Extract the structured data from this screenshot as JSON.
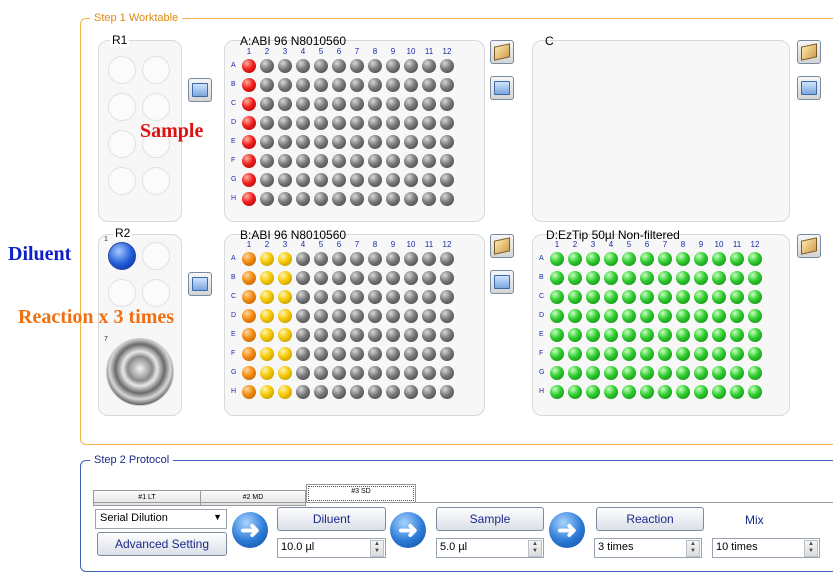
{
  "step1": {
    "legend": "Step 1 Worktable",
    "rack_r1": {
      "label": "R1"
    },
    "rack_r2": {
      "label": "R2",
      "slot1_num": "1",
      "slot7_num": "7"
    },
    "plate_a": {
      "title": "A:ABI 96 N8010560"
    },
    "plate_b": {
      "title": "B:ABI 96 N8010560"
    },
    "plate_c": {
      "title": "C"
    },
    "plate_d": {
      "title": "D:EzTip 50µl Non-filtered"
    },
    "columns": [
      "1",
      "2",
      "3",
      "4",
      "5",
      "6",
      "7",
      "8",
      "9",
      "10",
      "11",
      "12"
    ],
    "rows": [
      "A",
      "B",
      "C",
      "D",
      "E",
      "F",
      "G",
      "H"
    ]
  },
  "annotations": {
    "sample": "Sample",
    "diluent": "Diluent",
    "reaction": "Reaction x 3 times"
  },
  "step2": {
    "legend": "Step 2 Protocol",
    "tabs": [
      "#1 LT",
      "#2 MD",
      "#3 SD"
    ],
    "mode_select": "Serial Dilution",
    "advanced_button": "Advanced Setting",
    "diluent_button": "Diluent",
    "diluent_value": "10.0 µl",
    "sample_button": "Sample",
    "sample_value": "5.0 µl",
    "reaction_button": "Reaction",
    "reaction_value": "3 times",
    "mix_label": "Mix",
    "mix_value": "10 times"
  },
  "colors": {
    "worktable_border": "#f2b44a",
    "protocol_border": "#3c5fb4",
    "sample_annotation": "#e01010",
    "diluent_annotation": "#1020c8",
    "reaction_annotation": "#f07010"
  }
}
